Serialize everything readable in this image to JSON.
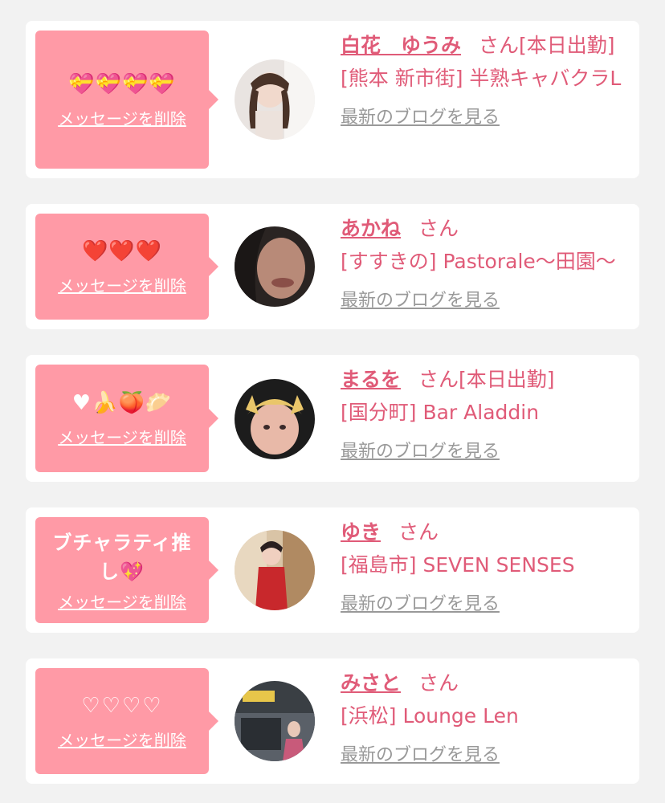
{
  "entries": [
    {
      "message": "💝💝💝💝",
      "delete_label": "メッセージを削除",
      "name": "白花　ゆうみ",
      "honorific": "さん[本日出勤]",
      "shop": "[熊本 新市街] 半熟キャバクラL",
      "blog_label": "最新のブログを見る"
    },
    {
      "message": "❤️❤️❤️",
      "delete_label": "メッセージを削除",
      "name": "あかね",
      "honorific": "さん",
      "shop": "[すすきの] Pastorale〜田園〜",
      "blog_label": "最新のブログを見る"
    },
    {
      "message": "♥︎🍌🍑🥟",
      "delete_label": "メッセージを削除",
      "name": "まるを",
      "honorific": "さん[本日出勤]",
      "shop": "[国分町] Bar Aladdin",
      "blog_label": "最新のブログを見る"
    },
    {
      "message": "ブチャラティ推し💖",
      "delete_label": "メッセージを削除",
      "name": "ゆき",
      "honorific": "さん",
      "shop": "[福島市] SEVEN SENSES",
      "blog_label": "最新のブログを見る"
    },
    {
      "message": "♡♡♡♡",
      "delete_label": "メッセージを削除",
      "name": "みさと",
      "honorific": "さん",
      "shop": "[浜松] Lounge Len",
      "blog_label": "最新のブログを見る"
    }
  ],
  "colors": {
    "background": "#f2f2f2",
    "card": "#ffffff",
    "bubble": "#ff9aa6",
    "accent_pink": "#e05b78",
    "link_gray": "#999999"
  }
}
